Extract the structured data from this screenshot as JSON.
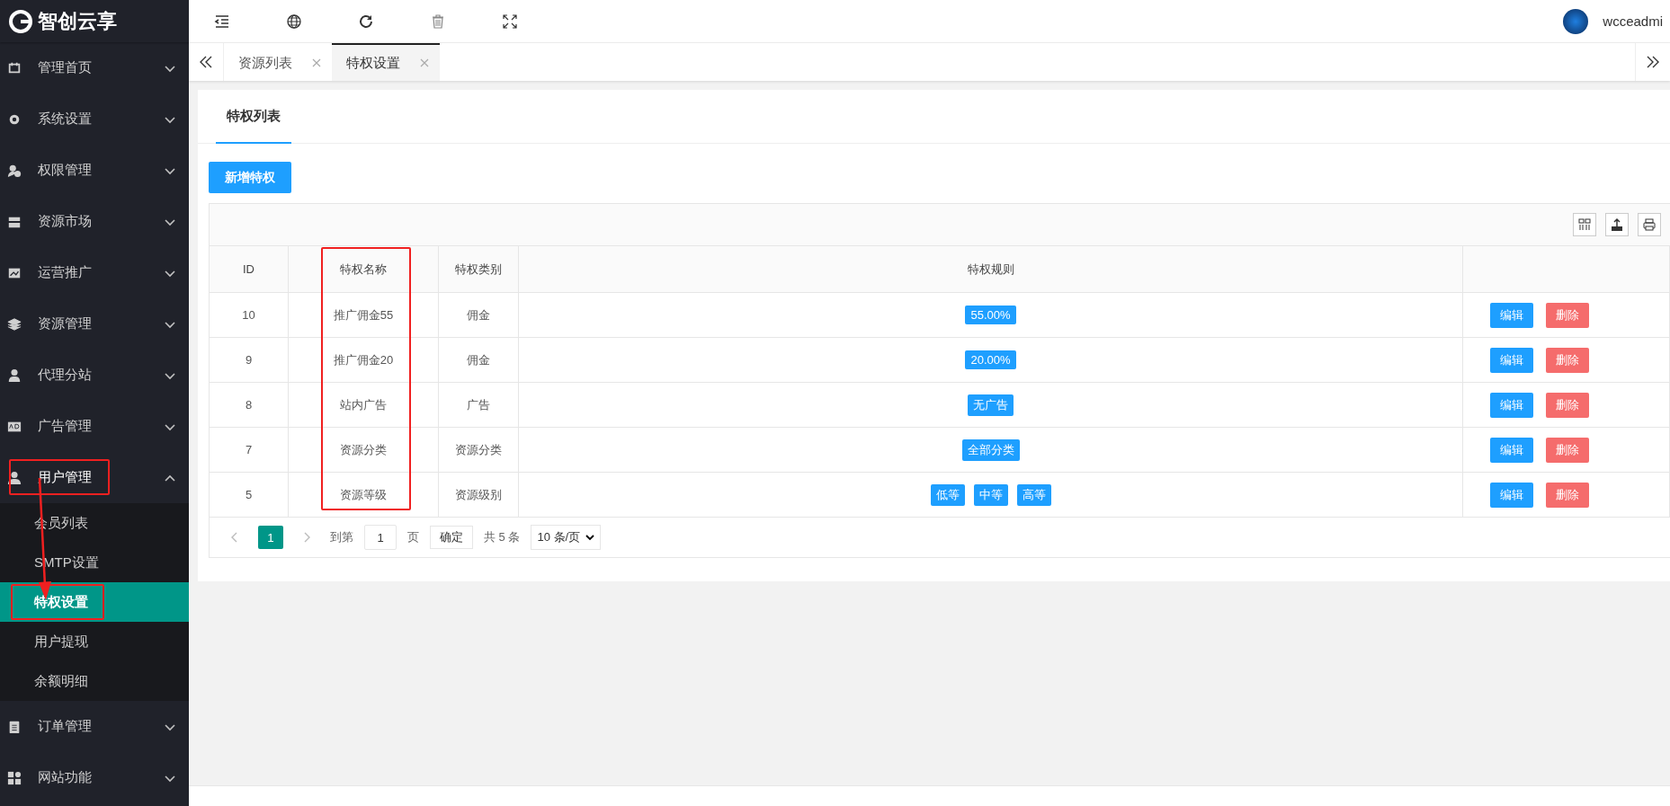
{
  "logo": {
    "text": "智创云享"
  },
  "sidebar": {
    "items": [
      {
        "label": "管理首页",
        "expanded": false,
        "annotated": false
      },
      {
        "label": "系统设置",
        "expanded": false,
        "annotated": false
      },
      {
        "label": "权限管理",
        "expanded": false,
        "annotated": false
      },
      {
        "label": "资源市场",
        "expanded": false,
        "annotated": false
      },
      {
        "label": "运营推广",
        "expanded": false,
        "annotated": false
      },
      {
        "label": "资源管理",
        "expanded": false,
        "annotated": false
      },
      {
        "label": "代理分站",
        "expanded": false,
        "annotated": false
      },
      {
        "label": "广告管理",
        "expanded": false,
        "annotated": false
      },
      {
        "label": "用户管理",
        "expanded": true,
        "annotated": true,
        "children": [
          {
            "label": "会员列表",
            "selected": false,
            "annotated": false
          },
          {
            "label": "SMTP设置",
            "selected": false,
            "annotated": false
          },
          {
            "label": "特权设置",
            "selected": true,
            "annotated": true
          },
          {
            "label": "用户提现",
            "selected": false,
            "annotated": false
          },
          {
            "label": "余额明细",
            "selected": false,
            "annotated": false
          }
        ]
      },
      {
        "label": "订单管理",
        "expanded": false,
        "annotated": false
      },
      {
        "label": "网站功能",
        "expanded": false,
        "annotated": false
      }
    ]
  },
  "topbar": {
    "user": "wcceadmi"
  },
  "tabs": [
    {
      "label": "资源列表",
      "selected": false
    },
    {
      "label": "特权设置",
      "selected": true
    }
  ],
  "card_tabs": [
    {
      "label": "特权列表",
      "selected": true
    }
  ],
  "add_button": "新增特权",
  "table": {
    "columns": [
      {
        "label": "ID",
        "annotated": false
      },
      {
        "label": "特权名称",
        "annotated": true
      },
      {
        "label": "特权类别",
        "annotated": false
      },
      {
        "label": "特权规则",
        "annotated": false
      },
      {
        "annotated": false
      }
    ],
    "rows": [
      {
        "id": "10",
        "name": "推广佣金55",
        "type": "佣金",
        "rules": [
          "55.00%"
        ],
        "edit": "编辑",
        "delete": "删除"
      },
      {
        "id": "9",
        "name": "推广佣金20",
        "type": "佣金",
        "rules": [
          "20.00%"
        ],
        "edit": "编辑",
        "delete": "删除"
      },
      {
        "id": "8",
        "name": "站内广告",
        "type": "广告",
        "rules": [
          "无广告"
        ],
        "edit": "编辑",
        "delete": "删除"
      },
      {
        "id": "7",
        "name": "资源分类",
        "type": "资源分类",
        "rules": [
          "全部分类"
        ],
        "edit": "编辑",
        "delete": "删除"
      },
      {
        "id": "5",
        "name": "资源等级",
        "type": "资源级别",
        "rules": [
          "低等",
          "中等",
          "高等"
        ],
        "edit": "编辑",
        "delete": "删除"
      }
    ]
  },
  "pagination": {
    "current": "1",
    "goto_label": "到第",
    "page_input": "1",
    "page_label": "页",
    "confirm": "确定",
    "total": "共 5 条",
    "page_size": "10 条/页"
  }
}
